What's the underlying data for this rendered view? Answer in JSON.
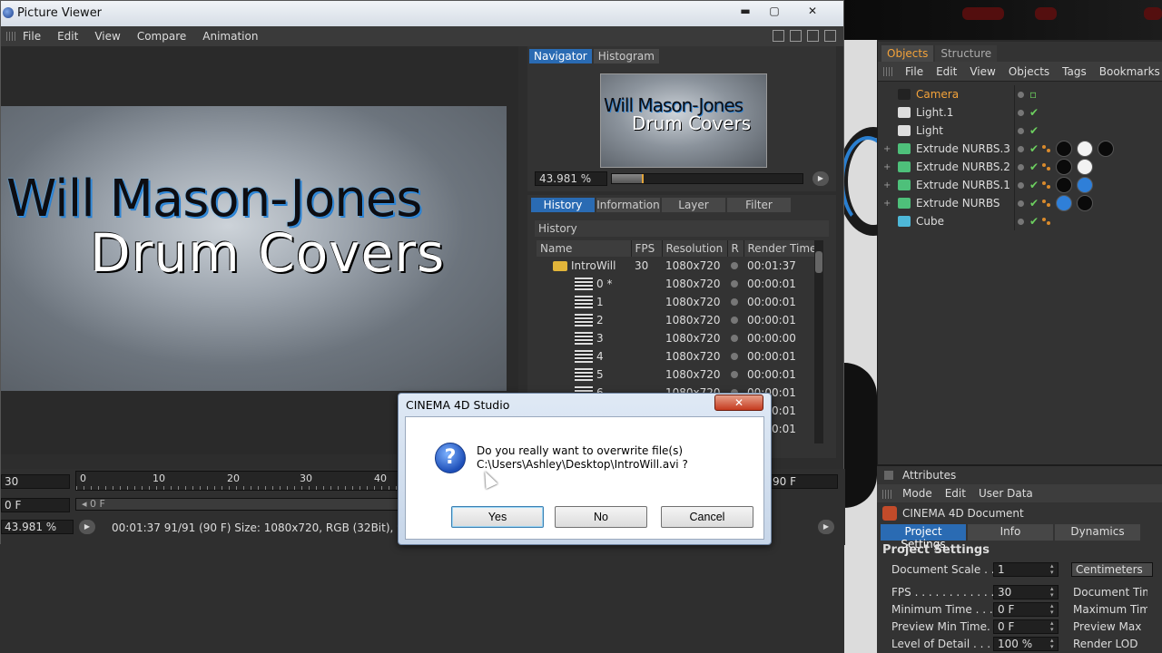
{
  "picture_viewer": {
    "title": "Picture Viewer",
    "menu": [
      "File",
      "Edit",
      "View",
      "Compare",
      "Animation"
    ],
    "window_buttons": [
      "▬",
      "▢",
      "✕"
    ],
    "image_text": {
      "line1": "Will Mason-Jones",
      "line2": "Drum Covers"
    },
    "navigator": {
      "tabs": [
        "Navigator",
        "Histogram"
      ],
      "zoom": "43.981 %"
    },
    "history": {
      "tabs": [
        "History",
        "Information",
        "Layer",
        "Filter"
      ],
      "label": "History",
      "columns": [
        "Name",
        "FPS",
        "Resolution",
        "R",
        "Render Time"
      ],
      "rows": [
        {
          "name": "IntroWill",
          "fps": "30",
          "res": "1080x720",
          "time": "00:01:37",
          "folder": true
        },
        {
          "name": "0 *",
          "fps": "",
          "res": "1080x720",
          "time": "00:00:01"
        },
        {
          "name": "1",
          "fps": "",
          "res": "1080x720",
          "time": "00:00:01"
        },
        {
          "name": "2",
          "fps": "",
          "res": "1080x720",
          "time": "00:00:01"
        },
        {
          "name": "3",
          "fps": "",
          "res": "1080x720",
          "time": "00:00:00"
        },
        {
          "name": "4",
          "fps": "",
          "res": "1080x720",
          "time": "00:00:01"
        },
        {
          "name": "5",
          "fps": "",
          "res": "1080x720",
          "time": "00:00:01"
        },
        {
          "name": "6",
          "fps": "",
          "res": "1080x720",
          "time": "00:00:01"
        },
        {
          "name": "",
          "fps": "",
          "res": "",
          "time": "00:00:01"
        },
        {
          "name": "",
          "fps": "",
          "res": "",
          "time": "00:00:01"
        }
      ]
    },
    "timeline": {
      "fps_field": "30",
      "frame_field": "0 F",
      "ruler_ticks": [
        "0",
        "10",
        "20",
        "30",
        "40"
      ],
      "scrub_label": "◂ 0 F",
      "end_field": "90 F",
      "zoom_field": "43.981 %",
      "status": "00:01:37 91/91 (90 F)   Size: 1080x720, RGB (32Bit), 9..."
    }
  },
  "dialog": {
    "title": "CINEMA 4D Studio",
    "close": "✕",
    "icon": "?",
    "message_line1": "Do you really want to overwrite file(s)",
    "message_line2": "C:\\Users\\Ashley\\Desktop\\IntroWill.avi ?",
    "buttons": {
      "yes": "Yes",
      "no": "No",
      "cancel": "Cancel"
    }
  },
  "objects_manager": {
    "tabs": [
      "Objects",
      "Structure"
    ],
    "menu": [
      "File",
      "Edit",
      "View",
      "Objects",
      "Tags",
      "Bookmarks"
    ],
    "items": [
      {
        "name": "Camera",
        "icon": "camera-icon",
        "tags": []
      },
      {
        "name": "Light.1",
        "icon": "light-icon",
        "tags": []
      },
      {
        "name": "Light",
        "icon": "light-icon",
        "tags": []
      },
      {
        "name": "Extrude NURBS.3",
        "icon": "extrude-icon",
        "tags": [
          "#0a0a0a",
          "#f2f2f2",
          "#0a0a0a"
        ]
      },
      {
        "name": "Extrude NURBS.2",
        "icon": "extrude-icon",
        "tags": [
          "#0a0a0a",
          "#f2f2f2"
        ]
      },
      {
        "name": "Extrude NURBS.1",
        "icon": "extrude-icon",
        "tags": [
          "#0a0a0a",
          "#2f7fd8"
        ]
      },
      {
        "name": "Extrude NURBS",
        "icon": "extrude-icon",
        "tags": [
          "#2f7fd8",
          "#0a0a0a"
        ]
      },
      {
        "name": "Cube",
        "icon": "cube-icon",
        "tags": []
      }
    ]
  },
  "attributes": {
    "title": "Attributes",
    "menu": [
      "Mode",
      "Edit",
      "User Data"
    ],
    "doc": "CINEMA 4D Document",
    "tabs": [
      "Project Settings",
      "Info",
      "Dynamics"
    ],
    "section": "Project Settings",
    "rows": [
      {
        "label": "Document Scale . .",
        "value": "1",
        "right": "Centimeters",
        "dropdown": true
      },
      {
        "label": "FPS . . . . . . . . . . . .",
        "value": "30",
        "right": "Document Tim"
      },
      {
        "label": "Minimum Time . . . .",
        "value": "0 F",
        "right": "Maximum Tim"
      },
      {
        "label": "Preview Min Time. .",
        "value": "0 F",
        "right": "Preview Max"
      },
      {
        "label": "Level of Detail . . . .",
        "value": "100 %",
        "right": "Render LOD"
      }
    ]
  },
  "colors": {
    "accent_blue": "#2a6bb3",
    "orange_active": "#f4a33a",
    "check_green": "#6ccf5f"
  }
}
